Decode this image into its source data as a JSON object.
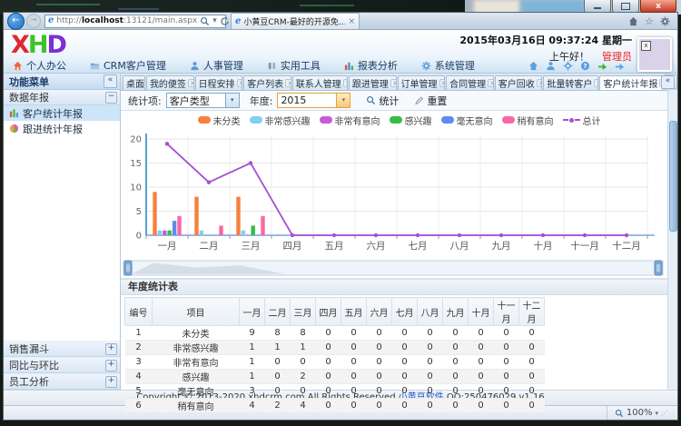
{
  "desktop": {
    "window_buttons": [
      "minimize",
      "maximize",
      "close"
    ]
  },
  "browser": {
    "url": {
      "protocol": "http://",
      "host": "localhost",
      "path": ":13121/main.aspx"
    },
    "tab_title": "小黄豆CRM-最好的开源免...",
    "nav_icons": [
      "home-icon",
      "star-icon",
      "gear-icon"
    ],
    "status_zoom": "100%"
  },
  "app": {
    "logo_letters": [
      "X",
      "H",
      "D"
    ],
    "logo_colors": [
      "#e02830",
      "#3dc32a",
      "#7b2fd8"
    ],
    "datetime": "2015年03月16日 09:37:24 星期一",
    "greeting": "上午好！",
    "username": "管理员",
    "quick_icons": [
      "home-icon",
      "user-icon",
      "gear-icon",
      "help-icon",
      "green-arrow-icon",
      "blue-arrow-icon"
    ]
  },
  "menu": {
    "items": [
      {
        "label": "个人办公",
        "icon": "home-orange-icon"
      },
      {
        "label": "CRM客户管理",
        "icon": "folder-icon"
      },
      {
        "label": "人事管理",
        "icon": "person-icon"
      },
      {
        "label": "实用工具",
        "icon": "tools-icon"
      },
      {
        "label": "报表分析",
        "icon": "chart-icon"
      },
      {
        "label": "系统管理",
        "icon": "gear-blue-icon"
      }
    ]
  },
  "tabs": {
    "items": [
      {
        "label": "桌面",
        "closable": false,
        "active": false
      },
      {
        "label": "我的便签",
        "closable": true,
        "active": false
      },
      {
        "label": "日程安排",
        "closable": true,
        "active": false
      },
      {
        "label": "客户列表",
        "closable": true,
        "active": false
      },
      {
        "label": "联系人管理",
        "closable": true,
        "active": false
      },
      {
        "label": "跟进管理",
        "closable": true,
        "active": false
      },
      {
        "label": "订单管理",
        "closable": true,
        "active": false
      },
      {
        "label": "合同管理",
        "closable": true,
        "active": false
      },
      {
        "label": "客户回收",
        "closable": true,
        "active": false
      },
      {
        "label": "批量转客户",
        "closable": true,
        "active": false
      },
      {
        "label": "客户统计年报",
        "closable": true,
        "active": true
      }
    ]
  },
  "sidebar": {
    "title": "功能菜单",
    "group_title": "数据年报",
    "items": [
      {
        "label": "客户统计年报",
        "icon": "bar-chart-icon",
        "selected": true
      },
      {
        "label": "跟进统计年报",
        "icon": "pie-chart-icon",
        "selected": false
      }
    ],
    "collapsed_groups": [
      "销售漏斗",
      "同比与环比",
      "员工分析"
    ]
  },
  "filters": {
    "stat_label": "统计项:",
    "stat_value": "客户类型",
    "year_label": "年度:",
    "year_value": "2015",
    "stat_button": "统计",
    "reset_button": "重置"
  },
  "chart_data": {
    "type": "bar",
    "title": "",
    "categories": [
      "一月",
      "二月",
      "三月",
      "四月",
      "五月",
      "六月",
      "七月",
      "八月",
      "九月",
      "十月",
      "十一月",
      "十二月"
    ],
    "series": [
      {
        "name": "未分类",
        "color": "#f5813e",
        "values": [
          9,
          8,
          8,
          0,
          0,
          0,
          0,
          0,
          0,
          0,
          0,
          0
        ]
      },
      {
        "name": "非常感兴趣",
        "color": "#82cff2",
        "values": [
          1,
          1,
          1,
          0,
          0,
          0,
          0,
          0,
          0,
          0,
          0,
          0
        ]
      },
      {
        "name": "非常有意向",
        "color": "#c95cd4",
        "values": [
          1,
          0,
          0,
          0,
          0,
          0,
          0,
          0,
          0,
          0,
          0,
          0
        ]
      },
      {
        "name": "感兴趣",
        "color": "#37bc46",
        "values": [
          1,
          0,
          2,
          0,
          0,
          0,
          0,
          0,
          0,
          0,
          0,
          0
        ]
      },
      {
        "name": "毫无意向",
        "color": "#5b8cee",
        "values": [
          3,
          0,
          0,
          0,
          0,
          0,
          0,
          0,
          0,
          0,
          0,
          0
        ]
      },
      {
        "name": "稍有意向",
        "color": "#f968a6",
        "values": [
          4,
          2,
          4,
          0,
          0,
          0,
          0,
          0,
          0,
          0,
          0,
          0
        ]
      }
    ],
    "line_series": {
      "name": "总计",
      "color": "#a74fd1",
      "values": [
        19,
        11,
        15,
        0,
        0,
        0,
        0,
        0,
        0,
        0,
        0,
        0
      ]
    },
    "ylim": [
      0,
      20
    ],
    "yticks": [
      0,
      5,
      10,
      15,
      20
    ],
    "grid": true,
    "legend_position": "top"
  },
  "table": {
    "title": "年度统计表",
    "columns": [
      "编号",
      "项目",
      "一月",
      "二月",
      "三月",
      "四月",
      "五月",
      "六月",
      "七月",
      "八月",
      "九月",
      "十月",
      "十一月",
      "十二月"
    ],
    "rows": [
      [
        "1",
        "未分类",
        "9",
        "8",
        "8",
        "0",
        "0",
        "0",
        "0",
        "0",
        "0",
        "0",
        "0",
        "0"
      ],
      [
        "2",
        "非常感兴趣",
        "1",
        "1",
        "1",
        "0",
        "0",
        "0",
        "0",
        "0",
        "0",
        "0",
        "0",
        "0"
      ],
      [
        "3",
        "非常有意向",
        "1",
        "0",
        "0",
        "0",
        "0",
        "0",
        "0",
        "0",
        "0",
        "0",
        "0",
        "0"
      ],
      [
        "4",
        "感兴趣",
        "1",
        "0",
        "2",
        "0",
        "0",
        "0",
        "0",
        "0",
        "0",
        "0",
        "0",
        "0"
      ],
      [
        "5",
        "毫无意向",
        "3",
        "0",
        "0",
        "0",
        "0",
        "0",
        "0",
        "0",
        "0",
        "0",
        "0",
        "0"
      ],
      [
        "6",
        "稍有意向",
        "4",
        "2",
        "4",
        "0",
        "0",
        "0",
        "0",
        "0",
        "0",
        "0",
        "0",
        "0"
      ]
    ]
  },
  "footer": {
    "prefix": "Copyright © 2013-2020 xhdcrm.com All Rights Reserved ",
    "link": "小黄豆软件",
    "suffix": " QQ:250476029 v1.16"
  },
  "ui": {
    "collapse_left": "«",
    "minus": "−",
    "plus": "+",
    "caret_down": "▼",
    "tab_close": "×",
    "combo_caret": "▾",
    "back_arrow": "←",
    "fwd_arrow": "→",
    "star": "☆",
    "close_x": "x"
  }
}
